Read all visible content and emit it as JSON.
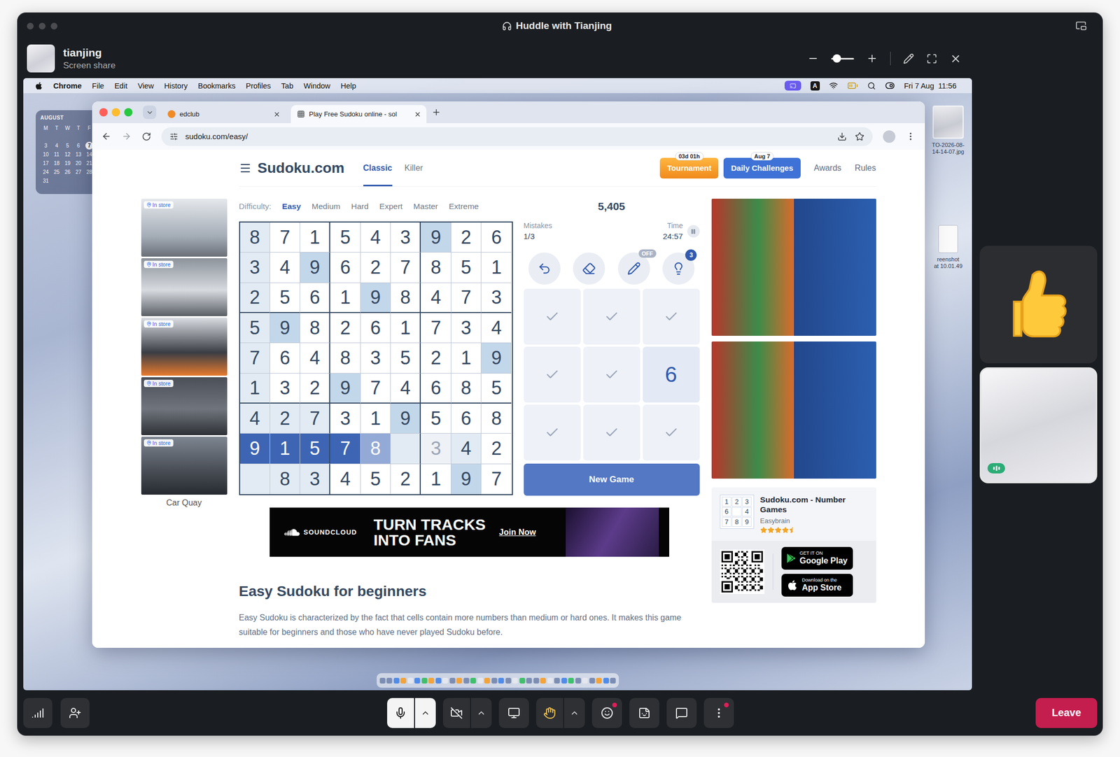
{
  "window": {
    "title": "Huddle with Tianjing"
  },
  "presenter": {
    "name": "tianjing",
    "subtitle": "Screen share"
  },
  "zoom": {
    "level": 0.25
  },
  "menubar": {
    "app": "Chrome",
    "items": [
      "File",
      "Edit",
      "View",
      "History",
      "Bookmarks",
      "Profiles",
      "Tab",
      "Window",
      "Help"
    ],
    "input": "A",
    "clock": "Fri 7 Aug  11:56"
  },
  "calendar": {
    "month": "AUGUST",
    "weekdays": [
      "M",
      "T",
      "W",
      "T",
      "F"
    ],
    "weeks": [
      [
        "3",
        "4",
        "5",
        "6",
        "7"
      ],
      [
        "10",
        "11",
        "12",
        "13",
        "14"
      ],
      [
        "17",
        "18",
        "19",
        "20",
        "21"
      ],
      [
        "24",
        "25",
        "26",
        "27",
        "28"
      ],
      [
        "31"
      ]
    ],
    "today": "7"
  },
  "desktop_files": [
    {
      "kind": "image",
      "lines": [
        "TO-2026-08-",
        "14-14-07.jpg"
      ]
    },
    {
      "kind": "document",
      "lines": [
        "reenshot",
        "at 10.01.49"
      ]
    }
  ],
  "browser": {
    "tabs": [
      {
        "label": "edclub",
        "selected": false
      },
      {
        "label": "Play Free Sudoku online - sol",
        "selected": true
      }
    ],
    "url": "sudoku.com/easy/"
  },
  "site": {
    "logo": "Sudoku.com",
    "modes": [
      {
        "label": "Classic",
        "selected": true
      },
      {
        "label": "Killer",
        "selected": false
      }
    ],
    "actions": [
      {
        "kind": "tournament",
        "label": "Tournament",
        "badge": "03d 01h"
      },
      {
        "kind": "daily",
        "label": "Daily Challenges",
        "badge": "Aug 7"
      }
    ],
    "links": [
      "Awards",
      "Rules"
    ]
  },
  "difficulty": {
    "label": "Difficulty:",
    "options": [
      {
        "label": "Easy",
        "selected": true
      },
      {
        "label": "Medium",
        "selected": false
      },
      {
        "label": "Hard",
        "selected": false
      },
      {
        "label": "Expert",
        "selected": false
      },
      {
        "label": "Master",
        "selected": false
      },
      {
        "label": "Extreme",
        "selected": false
      }
    ]
  },
  "score": "5,405",
  "mistakes": {
    "label": "Mistakes",
    "value": "1/3"
  },
  "timer": {
    "label": "Time",
    "value": "24:57"
  },
  "tools": [
    {
      "kind": "undo"
    },
    {
      "kind": "erase"
    },
    {
      "kind": "notes",
      "badge": "OFF"
    },
    {
      "kind": "hint",
      "badge": "3"
    }
  ],
  "grid": {
    "values": [
      [
        "8",
        "7",
        "1",
        "5",
        "4",
        "3",
        "9",
        "2",
        "6"
      ],
      [
        "3",
        "4",
        "9",
        "6",
        "2",
        "7",
        "8",
        "5",
        "1"
      ],
      [
        "2",
        "5",
        "6",
        "1",
        "9",
        "8",
        "4",
        "7",
        "3"
      ],
      [
        "5",
        "9",
        "8",
        "2",
        "6",
        "1",
        "7",
        "3",
        "4"
      ],
      [
        "7",
        "6",
        "4",
        "8",
        "3",
        "5",
        "2",
        "1",
        "9"
      ],
      [
        "1",
        "3",
        "2",
        "9",
        "7",
        "4",
        "6",
        "8",
        "5"
      ],
      [
        "4",
        "2",
        "7",
        "3",
        "1",
        "9",
        "5",
        "6",
        "8"
      ],
      [
        "9",
        "1",
        "5",
        "7",
        "8",
        "",
        "3",
        "4",
        "2"
      ],
      [
        "",
        "8",
        "3",
        "4",
        "5",
        "2",
        "1",
        "9",
        "7"
      ]
    ],
    "highlight": [
      [
        "related",
        "plain",
        "plain",
        "plain",
        "plain",
        "plain",
        "same",
        "plain",
        "plain"
      ],
      [
        "related",
        "plain",
        "same",
        "plain",
        "plain",
        "plain",
        "plain",
        "plain",
        "plain"
      ],
      [
        "related",
        "plain",
        "plain",
        "plain",
        "same",
        "plain",
        "plain",
        "plain",
        "plain"
      ],
      [
        "related",
        "same",
        "plain",
        "plain",
        "plain",
        "plain",
        "plain",
        "plain",
        "plain"
      ],
      [
        "related",
        "plain",
        "plain",
        "plain",
        "plain",
        "plain",
        "plain",
        "plain",
        "same"
      ],
      [
        "related",
        "plain",
        "plain",
        "same",
        "plain",
        "plain",
        "plain",
        "plain",
        "plain"
      ],
      [
        "related",
        "related",
        "related",
        "plain",
        "plain",
        "same",
        "plain",
        "plain",
        "plain"
      ],
      [
        "flash",
        "flash",
        "flash",
        "flash",
        "fade",
        "related",
        "dim",
        "related",
        "plain"
      ],
      [
        "related",
        "related",
        "related",
        "plain",
        "plain",
        "plain",
        "plain",
        "same",
        "plain"
      ]
    ]
  },
  "numpad": [
    {
      "done": true
    },
    {
      "done": true
    },
    {
      "done": true
    },
    {
      "done": true
    },
    {
      "done": true
    },
    {
      "label": "6",
      "done": false
    },
    {
      "done": true
    },
    {
      "done": true
    },
    {
      "done": true
    }
  ],
  "new_game": "New Game",
  "left_ads": {
    "items": [
      {
        "badge": "In store"
      },
      {
        "badge": "In store"
      },
      {
        "badge": "In store"
      },
      {
        "badge": "In store"
      },
      {
        "badge": "In store"
      }
    ],
    "caption": "Car Quay"
  },
  "banner": {
    "brand": "SOUNDCLOUD",
    "headline": [
      "TURN TRACKS",
      "INTO FANS"
    ],
    "cta": "Join Now"
  },
  "app_promo": {
    "icon_digits": [
      "1",
      "2",
      "3",
      "6",
      "",
      "4",
      "7",
      "8",
      "9"
    ],
    "title": "Sudoku.com - Number Games",
    "publisher": "Easybrain",
    "stars": 4.5,
    "stores": [
      {
        "kind": "google",
        "small": "GET IT ON",
        "big": "Google Play"
      },
      {
        "kind": "apple",
        "small": "Download on the",
        "big": "App Store"
      }
    ]
  },
  "article": {
    "heading": "Easy Sudoku for beginners",
    "body": "Easy Sudoku is characterized by the fact that cells contain more numbers than medium or hard ones. It makes this game suitable for beginners and those who have never played Sudoku before."
  },
  "participants": [
    {
      "kind": "reaction"
    },
    {
      "kind": "video",
      "speaking": true
    }
  ],
  "toolbar": {
    "left": [
      {
        "kind": "signal"
      },
      {
        "kind": "add-person"
      }
    ],
    "center": [
      {
        "kind": "mic",
        "active": true,
        "menu": true,
        "dot": false
      },
      {
        "kind": "video-off",
        "active": false,
        "menu": true,
        "dot": false
      },
      {
        "kind": "share",
        "active": false,
        "menu": false,
        "dot": false
      },
      {
        "kind": "hand",
        "active": false,
        "menu": true,
        "dot": false
      },
      {
        "kind": "emoji",
        "active": false,
        "menu": false,
        "dot": true
      },
      {
        "kind": "sticker",
        "active": false,
        "menu": false,
        "dot": false
      },
      {
        "kind": "chat",
        "active": false,
        "menu": false,
        "dot": false
      },
      {
        "kind": "more",
        "active": false,
        "menu": false,
        "dot": true
      }
    ],
    "leave": "Leave"
  }
}
